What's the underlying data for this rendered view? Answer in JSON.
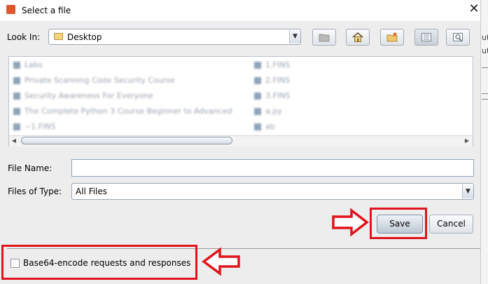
{
  "window": {
    "title": "Select a file",
    "close_glyph": "✕",
    "app_icon": "app-icon"
  },
  "toolbar": {
    "look_in_label": "Look In:",
    "look_in_value": "Desktop",
    "buttons": [
      {
        "name": "up-one-level",
        "icon": "folder-up-icon"
      },
      {
        "name": "home",
        "icon": "home-icon"
      },
      {
        "name": "new-folder",
        "icon": "new-folder-icon"
      },
      {
        "name": "list-view",
        "icon": "list-view-icon"
      },
      {
        "name": "details-view",
        "icon": "details-view-icon"
      }
    ]
  },
  "files": {
    "column1": [
      "Labs",
      "Private Scanning Code Security Course",
      "Security Awareness For Everyone",
      "The Complete Python 3 Course Beginner to Advanced",
      "~1.FINS"
    ],
    "column2": [
      "1.FINS",
      "2.FINS",
      "3.FINS",
      "a.py",
      "ab"
    ]
  },
  "form": {
    "file_name_label": "File Name:",
    "file_name_value": "",
    "files_of_type_label": "Files of Type:",
    "files_of_type_value": "All Files"
  },
  "actions": {
    "save_label": "Save",
    "cancel_label": "Cancel"
  },
  "options": {
    "base64_label": "Base64-encode requests and responses",
    "base64_checked": false
  },
  "right_strip": {
    "text1": "ut",
    "text2": "ut"
  },
  "colors": {
    "highlight": "#e0141c",
    "dialog_bg": "#ededed",
    "button_accent": "#7e8fa3"
  }
}
